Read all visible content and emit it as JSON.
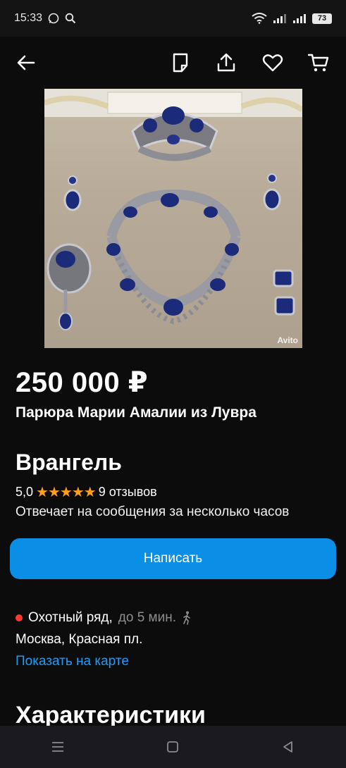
{
  "status_bar": {
    "time": "15:33",
    "battery": "73"
  },
  "listing": {
    "price": "250 000 ₽",
    "title": "Парюра Марии Амалии из Лувра",
    "watermark": "Avito"
  },
  "seller": {
    "name": "Врангель",
    "rating": "5,0",
    "stars": "★★★★★",
    "reviews": "9 отзывов",
    "response": "Отвечает на сообщения за несколько часов"
  },
  "actions": {
    "write_label": "Написать"
  },
  "location": {
    "metro": "Охотный ряд,",
    "walk": "до 5 мин.",
    "address": "Москва, Красная пл.",
    "map_link": "Показать на карте"
  },
  "sections": {
    "characteristics": "Характеристики"
  },
  "icons": {
    "back": "arrow-left-icon",
    "notes": "note-icon",
    "share": "share-icon",
    "favorite": "heart-icon",
    "cart": "cart-icon"
  },
  "colors": {
    "accent": "#0a8ee6",
    "link": "#1e9bf5",
    "star": "#ff9d1c",
    "metro": "#ff3b30"
  }
}
